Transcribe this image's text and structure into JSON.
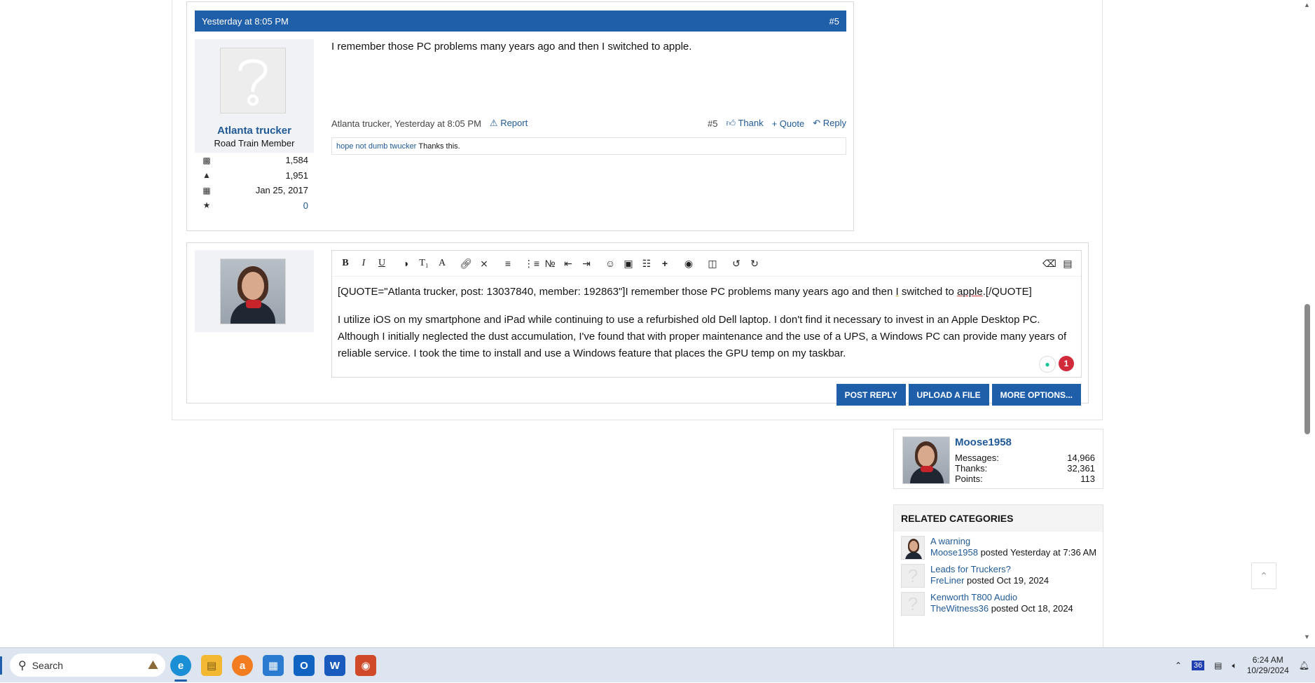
{
  "post": {
    "date": "Yesterday at 8:05 PM",
    "number": "#5",
    "author": {
      "name": "Atlanta trucker",
      "title": "Road Train Member",
      "messages": "1,584",
      "likes": "1,951",
      "joined": "Jan 25, 2017",
      "points": "0"
    },
    "body": "I remember those PC problems many years ago and then I switched to apple.",
    "meta_byline": "Atlanta trucker, Yesterday at 8:05 PM",
    "report_label": "Report",
    "meta_number": "#5",
    "thank_label": "Thank",
    "quote_label": "+ Quote",
    "reply_label": "Reply",
    "thanks_user": "hope not dumb twucker",
    "thanks_text": "Thanks this."
  },
  "editor": {
    "quote_open": "[QUOTE=\"Atlanta trucker, post: 13037840, member: 192863\"]I remember those PC problems many years ago and then ",
    "quote_i": "I",
    "quote_mid": " switched to ",
    "quote_apple": "apple",
    "quote_close": ".[/QUOTE]",
    "paragraph": "I utilize iOS on my smartphone and iPad while continuing to use a refurbished old Dell laptop. I don't find it necessary to invest in an Apple Desktop PC. Although I initially neglected the dust accumulation, I've found that with proper maintenance and the use of a UPS, a Windows PC can provide many years of reliable service. I took the time to install and use a Windows feature that places the GPU temp on my taskbar.",
    "grammar_badge_count": "1",
    "toolbar_icons": [
      "bold-icon",
      "italic-icon",
      "underline-icon",
      "color-icon",
      "font-size-icon",
      "font-icon",
      "link-icon",
      "unlink-icon",
      "align-icon",
      "bullet-list-icon",
      "numbered-list-icon",
      "outdent-icon",
      "indent-icon",
      "smilies-icon",
      "image-icon",
      "media-icon",
      "insert-icon",
      "screenshot-icon",
      "save-draft-icon",
      "undo-icon",
      "redo-icon",
      "remove-format-icon",
      "toggle-bbcode-icon"
    ]
  },
  "buttons": {
    "post_reply": "POST REPLY",
    "upload_file": "UPLOAD A FILE",
    "more_options": "MORE OPTIONS..."
  },
  "user_card": {
    "name": "Moose1958",
    "messages_label": "Messages:",
    "messages": "14,966",
    "thanks_label": "Thanks:",
    "thanks": "32,361",
    "points_label": "Points:",
    "points": "113"
  },
  "related": {
    "title": "RELATED CATEGORIES",
    "items": [
      {
        "title": "A warning",
        "user": "Moose1958",
        "posted": " posted Yesterday at 7:36 AM"
      },
      {
        "title": "Leads for Truckers?",
        "user": "FreLiner",
        "posted": " posted Oct 19, 2024"
      },
      {
        "title": "Kenworth T800 Audio",
        "user": "TheWitness36",
        "posted": " posted Oct 18, 2024"
      }
    ]
  },
  "taskbar": {
    "search_placeholder": "Search",
    "apps": [
      "edge-icon",
      "file-explorer-icon",
      "avast-icon",
      "store-icon",
      "outlook-icon",
      "word-icon",
      "app-icon"
    ],
    "tray_badge": "36",
    "time": "6:24 AM",
    "date": "10/29/2024"
  }
}
